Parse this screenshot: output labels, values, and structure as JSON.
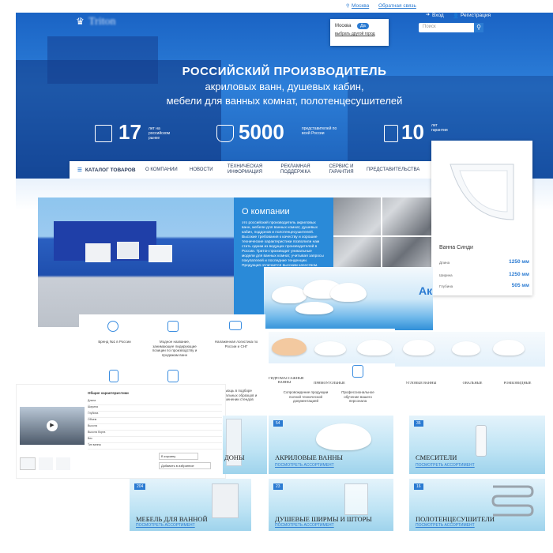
{
  "header": {
    "city": "Москва",
    "city_badge": "Да",
    "feedback": "Обратная связь",
    "login": "Вход",
    "register": "Регистрация",
    "search_placeholder": "Поиск",
    "city_popup_text": "Москва",
    "city_popup_link": "выбрать другой город",
    "logo": "Triton"
  },
  "hero": {
    "headline": "РОССИЙСКИЙ ПРОИЗВОДИТЕЛЬ",
    "line2": "акриловых ванн, душевых кабин,",
    "line3": "мебели для ванных комнат, полотенцесушителей",
    "stats": [
      {
        "num": "17",
        "text": "лет на российском рынке"
      },
      {
        "num": "5000",
        "text": "представителей по всей России"
      },
      {
        "num": "10",
        "text": "лет гарантии"
      }
    ]
  },
  "nav": {
    "catalog": "КАТАЛОГ ТОВАРОВ",
    "items": [
      "О КОМПАНИИ",
      "НОВОСТИ",
      "ТЕХНИЧЕСКАЯ ИНФОРМАЦИЯ",
      "РЕКЛАМНАЯ ПОДДЕРЖКА",
      "СЕРВИС И ГАРАНТИЯ",
      "ПРЕДСТАВИТЕЛЬСТВА"
    ]
  },
  "about": {
    "title": "О компании",
    "text": "это российский производитель акриловых ванн, мебели для ванных комнат, душевых кабин, поддонов и полотенцесушителей. Высокие требования к качеству и хорошие технические характеристики позволили нам стать одним из ведущих производителей в России. Тритон производит уникальные модели для ванных комнат, учитывая запросы покупателей и последние тенденции. Продукция отличается высоким качеством."
  },
  "product_card": {
    "name": "Ванна Синди",
    "specs": [
      {
        "label": "Длина",
        "value": "1250 мм"
      },
      {
        "label": "Ширина",
        "value": "1250 мм"
      },
      {
        "label": "Глубина",
        "value": "505 мм"
      }
    ]
  },
  "banner_text": "Ак",
  "features": [
    {
      "text": "Бренд №1 в России"
    },
    {
      "text": "Модное название, занимающее лидирующие позиции по производству и продажам ванн"
    },
    {
      "text": "Налаженная логистика по России и СНГ"
    },
    {
      "text": "Помощь в подборе оптимальных образцов и применении стендов"
    },
    {
      "text": "Сопровождение продукции полной технической документацией"
    },
    {
      "text": "Профессиональное обучение вашего персонала"
    }
  ],
  "mini_categories": [
    "ГИДРОМАССАЖНЫЕ ВАННЫ",
    "ПРЯМОУГОЛЬНЫЕ",
    "УГЛОВЫЕ ВАННЫ",
    "ОВАЛЬНЫЕ",
    "РОМБОВИДНЫЕ"
  ],
  "detail": {
    "title": "Общие характеристики",
    "rows": [
      "Длина",
      "Ширина",
      "Глубина",
      "Объем",
      "Высота",
      "Высота борта",
      "Вес",
      "Тип ванны",
      "Форма",
      "Вид гидромассажа"
    ],
    "buttons": [
      "В корзину",
      "Добавить в избранное"
    ]
  },
  "categories": [
    {
      "badge": "",
      "title": "ДОНЫ",
      "link": ""
    },
    {
      "badge": "54",
      "title": "АКРИЛОВЫЕ ВАННЫ",
      "link": "ПОСМОТРЕТЬ АССОРТИМЕНТ"
    },
    {
      "badge": "35",
      "title": "СМЕСИТЕЛИ",
      "link": "ПОСМОТРЕТЬ АССОРТИМЕНТ"
    },
    {
      "badge": "204",
      "title": "МЕБЕЛЬ ДЛЯ ВАННОЙ",
      "link": "ПОСМОТРЕТЬ АССОРТИМЕНТ"
    },
    {
      "badge": "23",
      "title": "ДУШЕВЫЕ ШИРМЫ И ШТОРЫ",
      "link": "ПОСМОТРЕТЬ АССОРТИМЕНТ"
    },
    {
      "badge": "16",
      "title": "ПОЛОТЕНЦЕСУШИТЕЛИ",
      "link": "ПОСМОТРЕТЬ АССОРТИМЕНТ"
    }
  ],
  "colors": {
    "brand_blue": "#2b7bd2",
    "hero_blue": "#1f6ccc",
    "text_dark": "#2a3b5a"
  }
}
